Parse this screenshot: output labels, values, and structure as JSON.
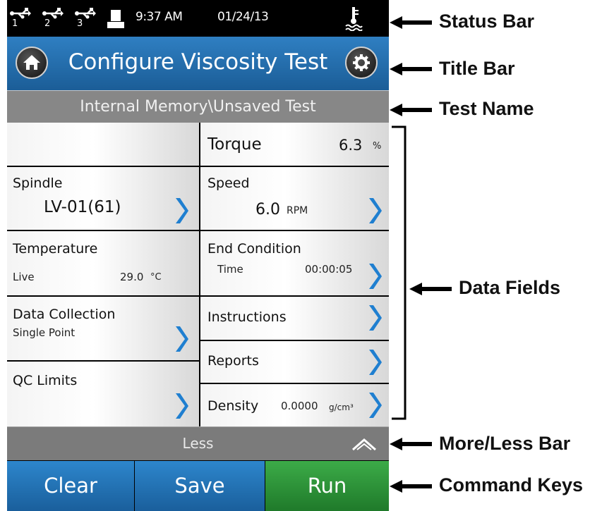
{
  "status_bar": {
    "usb_ports": [
      "1",
      "2",
      "3"
    ],
    "time": "9:37 AM",
    "date": "01/24/13"
  },
  "title_bar": {
    "title": "Configure Viscosity Test"
  },
  "test_name": "Internal Memory\\Unsaved Test",
  "fields": {
    "torque": {
      "label": "Torque",
      "value": "6.3",
      "unit": "%"
    },
    "spindle": {
      "label": "Spindle",
      "value": "LV-01(61)"
    },
    "speed": {
      "label": "Speed",
      "value": "6.0",
      "unit": "RPM"
    },
    "temperature": {
      "label": "Temperature",
      "mode": "Live",
      "value": "29.0",
      "unit": "°C"
    },
    "end_condition": {
      "label": "End Condition",
      "mode": "Time",
      "value": "00:00:05"
    },
    "data_collection": {
      "label": "Data Collection",
      "value": "Single Point"
    },
    "instructions": {
      "label": "Instructions"
    },
    "reports": {
      "label": "Reports"
    },
    "qc_limits": {
      "label": "QC Limits"
    },
    "density": {
      "label": "Density",
      "value": "0.0000",
      "unit": "g/cm³"
    }
  },
  "more_less_bar": {
    "label": "Less"
  },
  "command_keys": {
    "clear": "Clear",
    "save": "Save",
    "run": "Run"
  },
  "callouts": {
    "status_bar": "Status Bar",
    "title_bar": "Title Bar",
    "test_name": "Test Name",
    "data_fields": "Data Fields",
    "more_less_bar": "More/Less Bar",
    "command_keys": "Command Keys"
  },
  "colors": {
    "title_blue": "#2f7fc2",
    "run_green": "#3cab48",
    "chevron_blue": "#1f7fd0",
    "gray_bar": "#878787"
  }
}
